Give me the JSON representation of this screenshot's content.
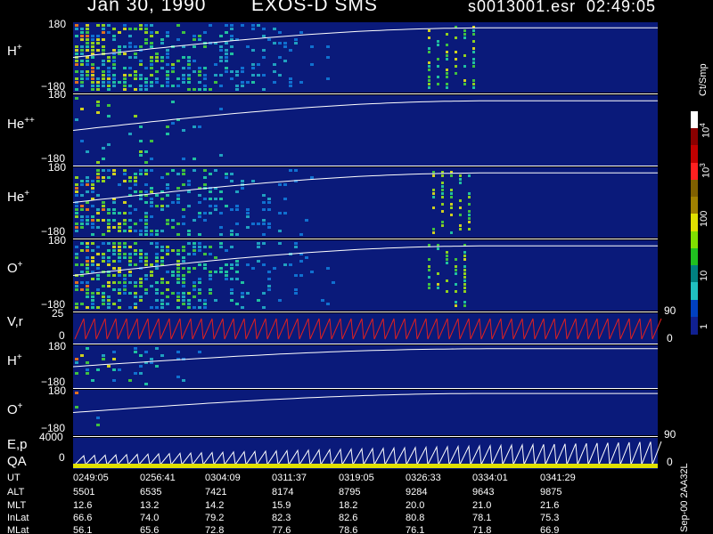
{
  "header": {
    "date": "Jan 30, 1990",
    "instrument": "EXOS-D SMS",
    "file": "s0013001.esr",
    "time": "02:49:05"
  },
  "panels": [
    {
      "id": "h-plus",
      "label": "H",
      "sup": "+",
      "y_top": "180",
      "y_bot": "−180"
    },
    {
      "id": "he-plusplus",
      "label": "He",
      "sup": "++",
      "y_top": "180",
      "y_bot": "−180"
    },
    {
      "id": "he-plus",
      "label": "He",
      "sup": "+",
      "y_top": "180",
      "y_bot": "−180"
    },
    {
      "id": "o-plus",
      "label": "O",
      "sup": "+",
      "y_top": "180",
      "y_bot": "−180",
      "right_tick": "90"
    },
    {
      "id": "vr",
      "label": "V,r",
      "sup": "",
      "y_top": "25",
      "y_bot": "0",
      "right_tick": "0"
    },
    {
      "id": "h-plus-2",
      "label": "H",
      "sup": "+",
      "y_top": "180",
      "y_bot": "−180"
    },
    {
      "id": "o-plus-2",
      "label": "O",
      "sup": "+",
      "y_top": "180",
      "y_bot": "−180",
      "right_tick": "90"
    },
    {
      "id": "ep",
      "label": "E,p",
      "sup": "",
      "label2": "QA",
      "y_top": "4000",
      "y_bot": "0",
      "right_tick": "0"
    }
  ],
  "colorbar": {
    "unit": "Ct/Smp",
    "tick_labels": [
      "10",
      "4",
      "10",
      "3",
      "100",
      "10",
      "1"
    ],
    "colors": [
      "#ffffff",
      "#8b0000",
      "#c00000",
      "#ff2020",
      "#806000",
      "#a08000",
      "#e0e000",
      "#80e000",
      "#20c020",
      "#008080",
      "#20c0c0",
      "#0040c0",
      "#102090"
    ]
  },
  "footer": {
    "rows": [
      {
        "name": "UT",
        "values": [
          "0249:05",
          "0256:41",
          "0304:09",
          "0311:37",
          "0319:05",
          "0326:33",
          "0334:01",
          "0341:29"
        ]
      },
      {
        "name": "ALT",
        "values": [
          "5501",
          "6535",
          "7421",
          "8174",
          "8795",
          "9284",
          "9643",
          "9875"
        ]
      },
      {
        "name": "MLT",
        "values": [
          "12.6",
          "13.2",
          "14.2",
          "15.9",
          "18.2",
          "20.0",
          "21.0",
          "21.6"
        ]
      },
      {
        "name": "InLat",
        "values": [
          "66.6",
          "74.0",
          "79.2",
          "82.3",
          "82.6",
          "80.8",
          "78.1",
          "75.3"
        ]
      },
      {
        "name": "MLat",
        "values": [
          "56.1",
          "65.6",
          "72.8",
          "77.6",
          "78.6",
          "76.1",
          "71.8",
          "66.9"
        ]
      }
    ],
    "side_text": "Sep-00 2AA32L"
  },
  "chart_data": {
    "type": "heatmap",
    "title": "Jan 30, 1990   EXOS-D SMS",
    "x_ticks_ut": [
      "0249:05",
      "0256:41",
      "0304:09",
      "0311:37",
      "0319:05",
      "0326:33",
      "0334:01",
      "0341:29"
    ],
    "species": [
      "H+",
      "He++",
      "He+",
      "O+",
      "H+",
      "O+"
    ],
    "y_range_deg": [
      -180,
      180
    ],
    "colorbar_unit": "Ct/Smp",
    "colorbar_range": [
      1,
      10000
    ]
  }
}
